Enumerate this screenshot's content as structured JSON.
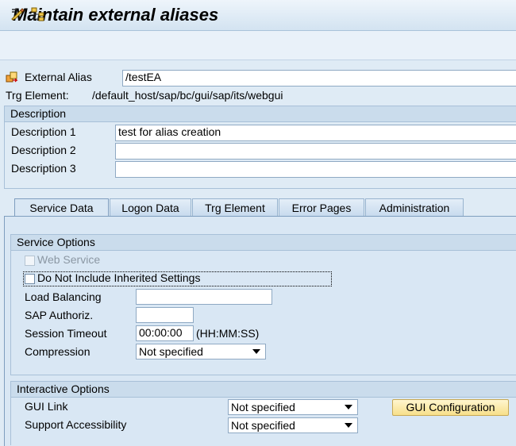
{
  "window": {
    "title": "Maintain external aliases"
  },
  "toolbar": {
    "icons": [
      "edit-icon",
      "hierarchy-icon"
    ]
  },
  "alias": {
    "label": "External Alias",
    "value": "/testEA",
    "trg_label": "Trg Element:",
    "trg_value": "/default_host/sap/bc/gui/sap/its/webgui"
  },
  "description": {
    "header": "Description",
    "fields": [
      {
        "label": "Description 1",
        "value": "test for alias creation"
      },
      {
        "label": "Description 2",
        "value": ""
      },
      {
        "label": "Description 3",
        "value": ""
      }
    ]
  },
  "tabs": [
    {
      "label": "Service Data",
      "active": true
    },
    {
      "label": "Logon Data",
      "active": false
    },
    {
      "label": "Trg Element",
      "active": false
    },
    {
      "label": "Error Pages",
      "active": false
    },
    {
      "label": "Administration",
      "active": false
    }
  ],
  "service_options": {
    "header": "Service Options",
    "web_service": {
      "label": "Web Service",
      "checked": false,
      "disabled": true
    },
    "no_inherit": {
      "label": "Do Not Include Inherited Settings",
      "checked": false
    },
    "load_balancing": {
      "label": "Load Balancing",
      "value": ""
    },
    "sap_authoriz": {
      "label": "SAP Authoriz.",
      "value": ""
    },
    "session_timeout": {
      "label": "Session Timeout",
      "value": "00:00:00",
      "hint": "(HH:MM:SS)"
    },
    "compression": {
      "label": "Compression",
      "value": "Not specified"
    }
  },
  "interactive_options": {
    "header": "Interactive Options",
    "gui_link": {
      "label": "GUI Link",
      "value": "Not specified"
    },
    "support_accessibility": {
      "label": "Support Accessibility",
      "value": "Not specified"
    },
    "gui_config_button": "GUI Configuration"
  }
}
